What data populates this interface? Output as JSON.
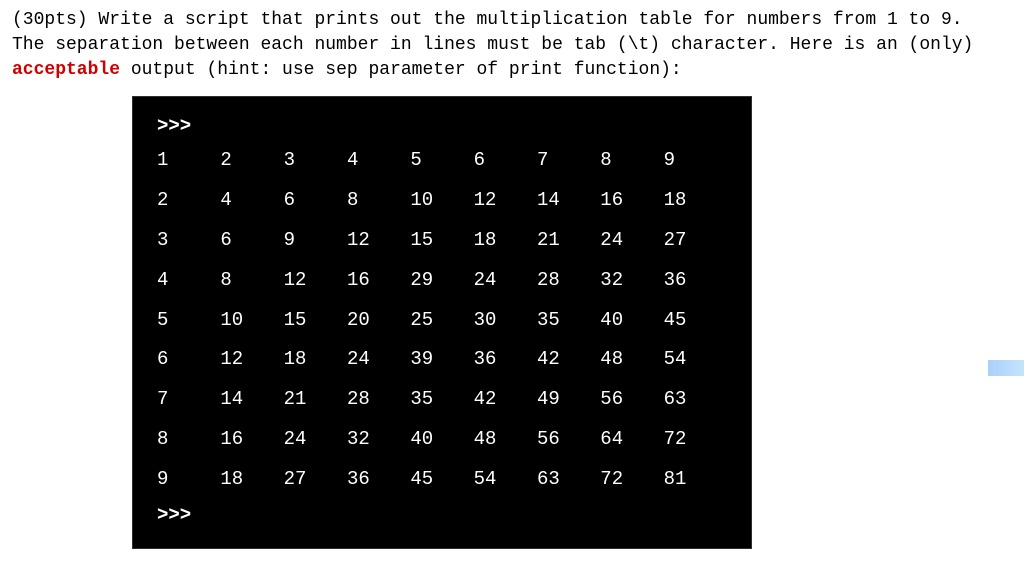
{
  "question": {
    "line1_pre": "(30pts) Write a script that prints out the multiplication table for numbers from 1 to 9.",
    "line2": "The separation between each number in lines must be tab (\\t) character. Here is an (only)",
    "line3_red": "acceptable",
    "line3_post": " output (hint: use sep parameter of print function):"
  },
  "terminal": {
    "prompt": ">>>",
    "rows": [
      [
        "1",
        "2",
        "3",
        "4",
        "5",
        "6",
        "7",
        "8",
        "9"
      ],
      [
        "2",
        "4",
        "6",
        "8",
        "10",
        "12",
        "14",
        "16",
        "18"
      ],
      [
        "3",
        "6",
        "9",
        "12",
        "15",
        "18",
        "21",
        "24",
        "27"
      ],
      [
        "4",
        "8",
        "12",
        "16",
        "29",
        "24",
        "28",
        "32",
        "36"
      ],
      [
        "5",
        "10",
        "15",
        "20",
        "25",
        "30",
        "35",
        "40",
        "45"
      ],
      [
        "6",
        "12",
        "18",
        "24",
        "39",
        "36",
        "42",
        "48",
        "54"
      ],
      [
        "7",
        "14",
        "21",
        "28",
        "35",
        "42",
        "49",
        "56",
        "63"
      ],
      [
        "8",
        "16",
        "24",
        "32",
        "40",
        "48",
        "56",
        "64",
        "72"
      ],
      [
        "9",
        "18",
        "27",
        "36",
        "45",
        "54",
        "63",
        "72",
        "81"
      ]
    ]
  }
}
